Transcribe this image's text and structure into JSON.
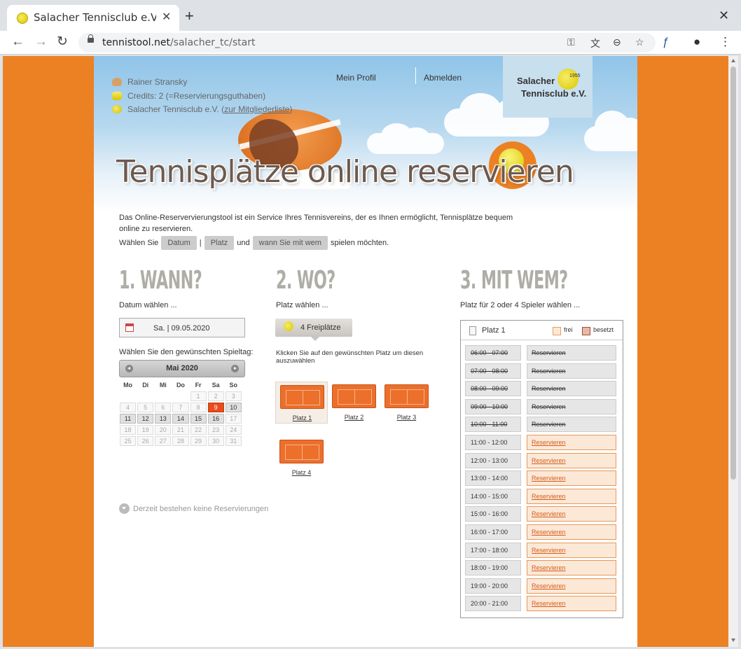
{
  "browser": {
    "tab_title": "Salacher Tennisclub e.V. |",
    "url_domain": "tennistool.net",
    "url_path": "/salacher_tc/start"
  },
  "user": {
    "name": "Rainer Stransky",
    "credits": "Credits: 2 (=Reservierungsguthaben)",
    "club_prefix": "Salacher Tennisclub e.V. (",
    "members_link": "zur Mitgliederliste",
    "club_suffix": ")"
  },
  "nav": {
    "profile": "Mein Profil",
    "logout": "Abmelden"
  },
  "logo": {
    "line1": "Salacher",
    "line2": "Tennisclub e.V.",
    "year": "1955"
  },
  "hero": {
    "title": "Tennisplätze online reservieren"
  },
  "intro": {
    "text": "Das Online-Reservervierungstool ist ein Service Ihres Tennisvereins, der es Ihnen ermöglicht, Tennisplätze bequem online zu reservieren.",
    "prefix": "Wählen Sie",
    "pill_date": "Datum",
    "separator": "|",
    "pill_court": "Platz",
    "and": "und",
    "pill_who": "wann Sie mit wem",
    "suffix": "spielen möchten."
  },
  "step1": {
    "title": "1. WANN?",
    "subtitle": "Datum wählen ...",
    "date_value": "Sa. | 09.05.2020",
    "calendar_label": "Wählen Sie den gewünschten Spieltag:",
    "month": "Mai 2020",
    "weekdays": [
      "Mo",
      "Di",
      "Mi",
      "Do",
      "Fr",
      "Sa",
      "So"
    ],
    "status": "Derzeit bestehen keine Reservierungen"
  },
  "step2": {
    "title": "2. WO?",
    "subtitle": "Platz wählen ...",
    "free_courts": "4 Freiplätze",
    "help": "Klicken Sie auf den gewünschten Platz um diesen auszuwählen",
    "courts": [
      "Platz 1",
      "Platz 2",
      "Platz 3",
      "Platz 4"
    ]
  },
  "step3": {
    "title": "3. MIT WEM?",
    "subtitle": "Platz für 2 oder 4 Spieler wählen ...",
    "panel_title": "Platz 1",
    "legend_free": "frei",
    "legend_busy": "besetzt",
    "reserve_label": "Reservieren",
    "slots": [
      {
        "time": "06:00 - 07:00",
        "state": "past"
      },
      {
        "time": "07:00 - 08:00",
        "state": "past"
      },
      {
        "time": "08:00 - 09:00",
        "state": "past"
      },
      {
        "time": "09:00 - 10:00",
        "state": "past"
      },
      {
        "time": "10:00 - 11:00",
        "state": "past"
      },
      {
        "time": "11:00 - 12:00",
        "state": "free"
      },
      {
        "time": "12:00 - 13:00",
        "state": "free"
      },
      {
        "time": "13:00 - 14:00",
        "state": "free"
      },
      {
        "time": "14:00 - 15:00",
        "state": "free"
      },
      {
        "time": "15:00 - 16:00",
        "state": "free"
      },
      {
        "time": "16:00 - 17:00",
        "state": "free"
      },
      {
        "time": "17:00 - 18:00",
        "state": "free"
      },
      {
        "time": "18:00 - 19:00",
        "state": "free"
      },
      {
        "time": "19:00 - 20:00",
        "state": "free"
      },
      {
        "time": "20:00 - 21:00",
        "state": "free"
      }
    ]
  },
  "colors": {
    "page_bg": "#ec8124",
    "today": "#e84c1d",
    "free_bg": "#fce8d7",
    "busy_legend": "#e6b8a8"
  },
  "icons": {
    "lock": "lock-icon",
    "key": "key-icon",
    "translate": "translate-icon",
    "zoom": "zoom-out-icon",
    "star": "star-icon",
    "profile": "account-icon",
    "menu": "more-vert-icon"
  }
}
